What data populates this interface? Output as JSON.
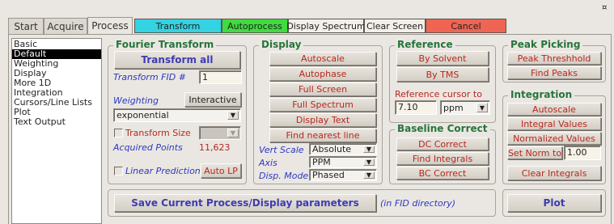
{
  "tabs": [
    "Start",
    "Acquire",
    "Process"
  ],
  "toolbar": {
    "transform": "Transform",
    "autoprocess": "Autoprocess",
    "display_spectrum": "Display Spectrum",
    "clear_screen": "Clear Screen",
    "cancel": "Cancel",
    "colors": {
      "transform": "#33d3e3",
      "autoprocess": "#3fdc3f",
      "cancel": "#ef6453"
    }
  },
  "sidebar": {
    "items": [
      "Basic",
      "Default",
      "Weighting",
      "Display",
      "More 1D",
      "Integration",
      "Cursors/Line Lists",
      "Plot",
      "Text Output"
    ],
    "selected": "Default"
  },
  "fourier": {
    "title": "Fourier Transform",
    "transform_all": "Transform all",
    "fid_label": "Transform FID #",
    "fid_value": "1",
    "weighting_label": "Weighting",
    "interactive": "Interactive",
    "weighting_value": "exponential",
    "transform_size_label": "Transform Size",
    "acquired_points_label": "Acquired Points",
    "acquired_points_value": "11,623",
    "linear_prediction_label": "Linear Prediction",
    "auto_lp": "Auto LP"
  },
  "display": {
    "title": "Display",
    "buttons": [
      "Autoscale",
      "Autophase",
      "Full Screen",
      "Full Spectrum",
      "Display Text",
      "Find nearest line"
    ],
    "vert_scale_label": "Vert Scale",
    "vert_scale_value": "Absolute",
    "axis_label": "Axis",
    "axis_value": "PPM",
    "disp_mode_label": "Disp. Mode",
    "disp_mode_value": "Phased"
  },
  "reference": {
    "title": "Reference",
    "by_solvent": "By Solvent",
    "by_tms": "By TMS",
    "cursor_label": "Reference cursor to",
    "cursor_value": "7.10",
    "unit": "ppm"
  },
  "baseline": {
    "title": "Baseline Correct",
    "buttons": [
      "DC Correct",
      "Find Integrals",
      "BC Correct"
    ]
  },
  "peak": {
    "title": "Peak Picking",
    "buttons": [
      "Peak Threshhold",
      "Find Peaks"
    ]
  },
  "integration": {
    "title": "Integration",
    "buttons": [
      "Autoscale",
      "Integral Values",
      "Normalized Values"
    ],
    "set_norm": "Set Norm to",
    "norm_value": "1.00",
    "clear": "Clear Integrals"
  },
  "bottom": {
    "save": "Save Current Process/Display parameters",
    "note": "(in FID directory)",
    "plot": "Plot"
  },
  "corner_glyph": "¤"
}
